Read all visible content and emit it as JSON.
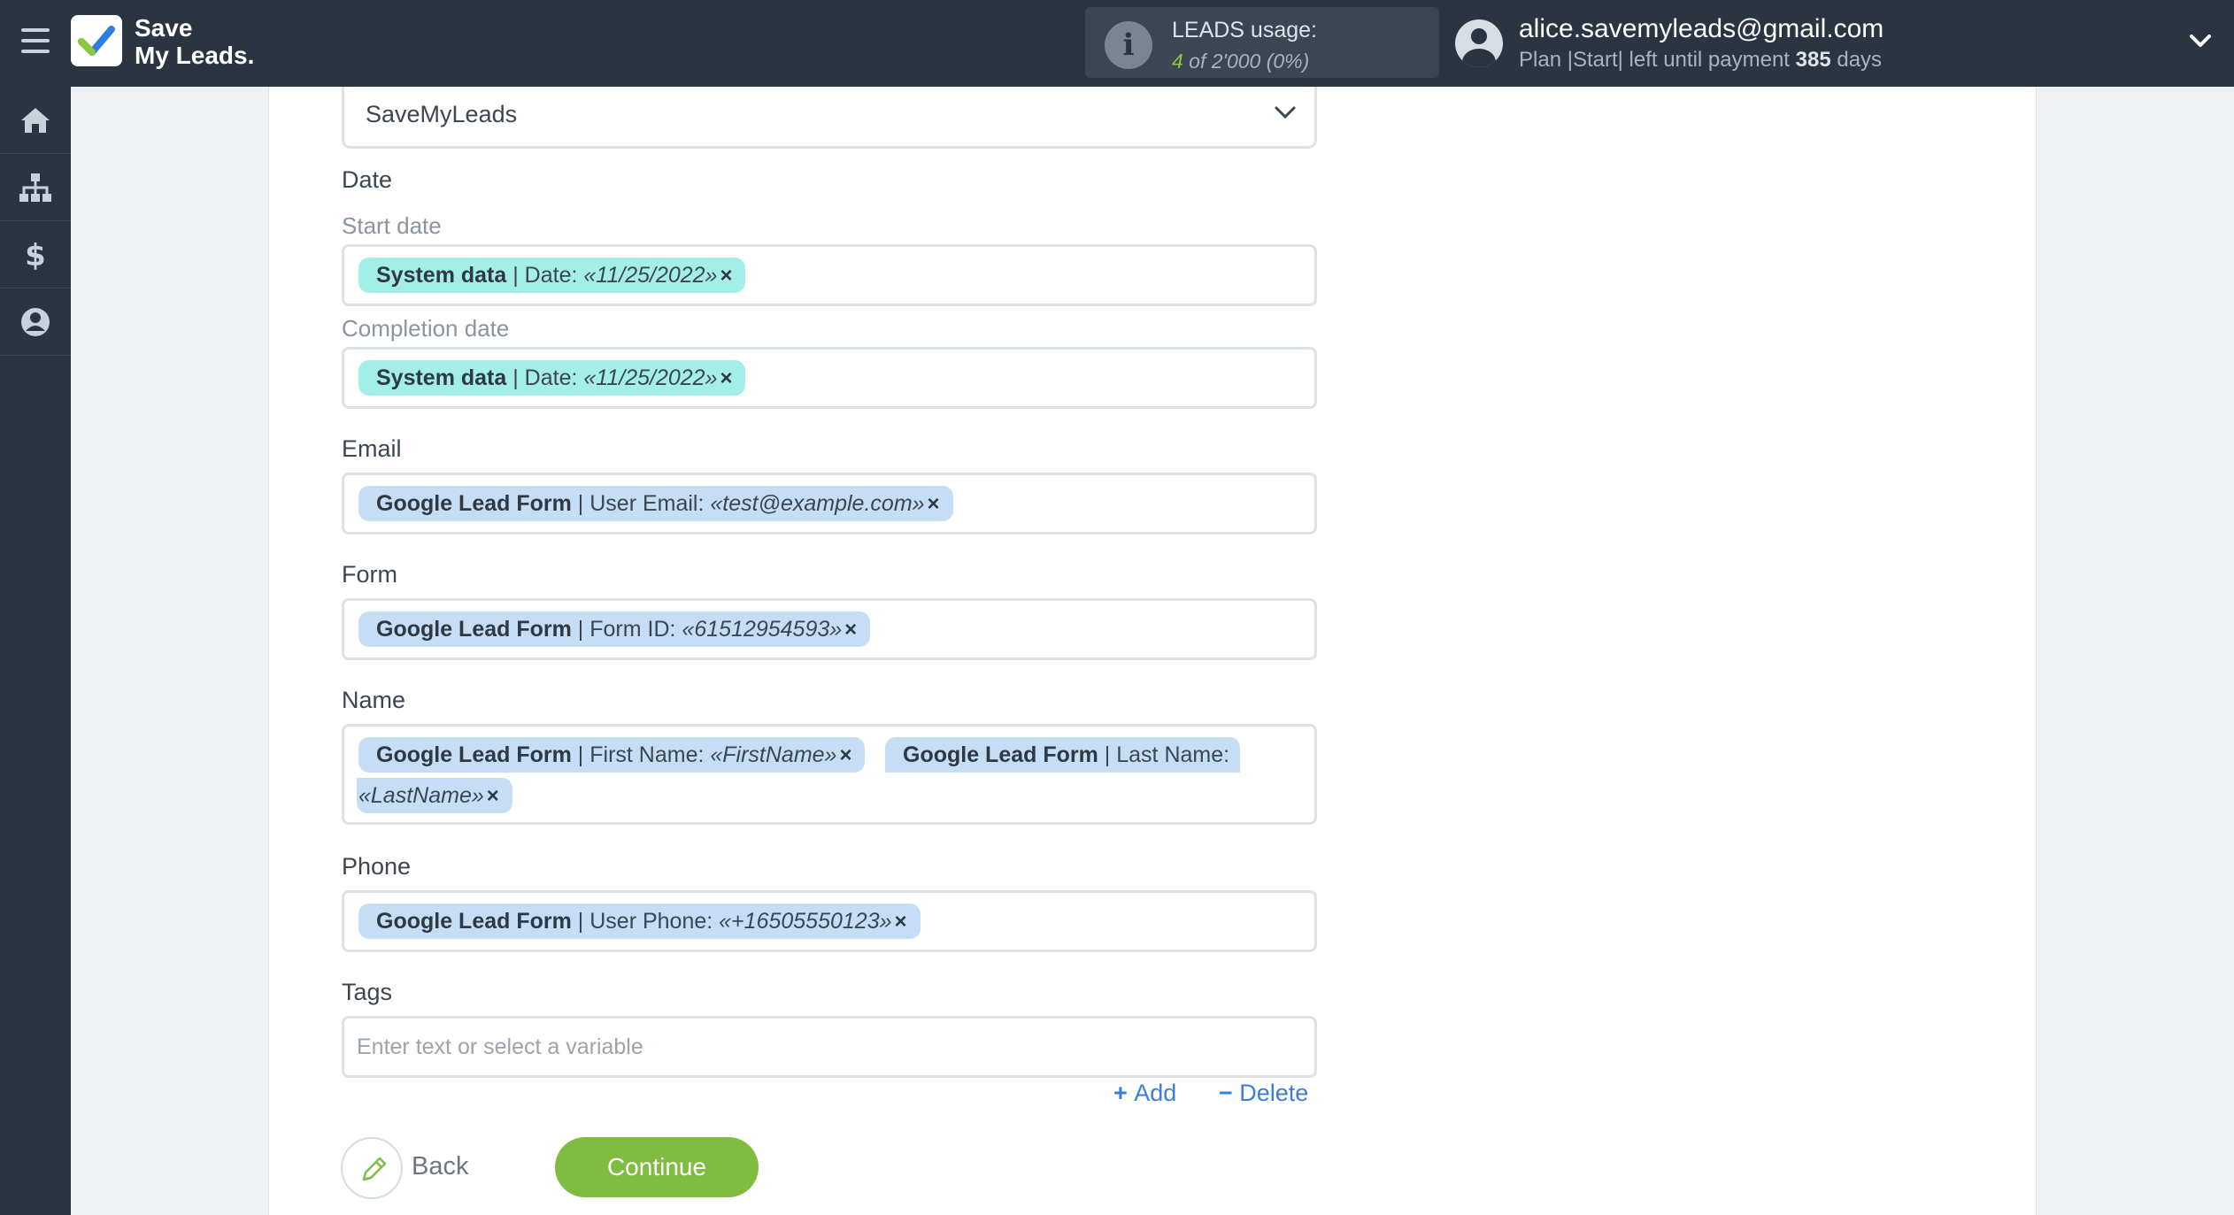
{
  "app": {
    "logo_line1": "Save",
    "logo_line2": "My Leads."
  },
  "usage": {
    "label": "LEADS usage:",
    "used": "4",
    "rest": " of 2'000 (0%)"
  },
  "user": {
    "email": "alice.savemyleads@gmail.com",
    "plan_prefix": "Plan |Start| left until payment ",
    "days": "385",
    "days_suffix": " days"
  },
  "form": {
    "account_select": "SaveMyLeads",
    "date": {
      "label": "Date",
      "start_label": "Start date",
      "completion_label": "Completion date",
      "start_chip": {
        "source": "System data",
        "field": " | Date: ",
        "value": "«11/25/2022»"
      },
      "completion_chip": {
        "source": "System data",
        "field": " | Date: ",
        "value": "«11/25/2022»"
      }
    },
    "email": {
      "label": "Email",
      "chip": {
        "source": "Google Lead Form",
        "field": " | User Email: ",
        "value": "«test@example.com»"
      }
    },
    "form_field": {
      "label": "Form",
      "chip": {
        "source": "Google Lead Form",
        "field": " | Form ID: ",
        "value": "«61512954593»"
      }
    },
    "name": {
      "label": "Name",
      "chip1": {
        "source": "Google Lead Form",
        "field": " | First Name: ",
        "value": "«FirstName»"
      },
      "chip2": {
        "source": "Google Lead Form",
        "field": " | Last Name: ",
        "value": "«LastName»"
      }
    },
    "phone": {
      "label": "Phone",
      "chip": {
        "source": "Google Lead Form",
        "field": " | User Phone: ",
        "value": "«+16505550123»"
      }
    },
    "tags": {
      "label": "Tags",
      "placeholder": "Enter text or select a variable"
    },
    "add_label": "Add",
    "delete_label": "Delete",
    "back_label": "Back",
    "continue_label": "Continue"
  },
  "colors": {
    "topbar": "#2a3541",
    "accent_green": "#7fbc41",
    "chip_teal": "#a3efe8",
    "chip_blue": "#c6ddf6",
    "link_blue": "#3a7ed8"
  },
  "icons": {
    "menu": "hamburger-icon",
    "home": "home-icon",
    "sitemap": "sitemap-icon",
    "billing": "dollar-icon",
    "profile": "user-circle-icon",
    "info": "info-icon",
    "edit": "pencil-icon"
  }
}
